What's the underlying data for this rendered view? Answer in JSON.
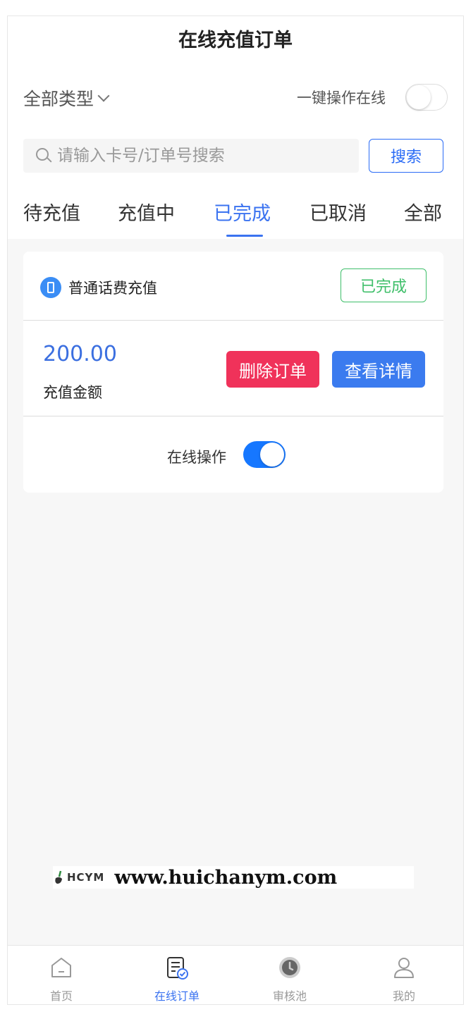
{
  "header": {
    "title": "在线充值订单"
  },
  "filter": {
    "type_label": "全部类型",
    "onekey_label": "一键操作在线",
    "onekey_on": false
  },
  "search": {
    "placeholder": "请输入卡号/订单号搜索",
    "button_label": "搜索"
  },
  "tabs": [
    {
      "label": "待充值",
      "active": false
    },
    {
      "label": "充值中",
      "active": false
    },
    {
      "label": "已完成",
      "active": true
    },
    {
      "label": "已取消",
      "active": false
    },
    {
      "label": "全部",
      "active": false
    }
  ],
  "order": {
    "type": "普通话费充值",
    "status": "已完成",
    "amount": "200.00",
    "amount_label": "充值金额",
    "delete_label": "删除订单",
    "detail_label": "查看详情",
    "online_label": "在线操作",
    "online_on": true
  },
  "watermark": {
    "logo": "HCYM",
    "url": "www.huichanym.com"
  },
  "bottom_nav": [
    {
      "label": "首页",
      "icon": "home-icon",
      "active": false
    },
    {
      "label": "在线订单",
      "icon": "order-icon",
      "active": true
    },
    {
      "label": "审核池",
      "icon": "clock-icon",
      "active": false
    },
    {
      "label": "我的",
      "icon": "user-icon",
      "active": false
    }
  ],
  "colors": {
    "accent": "#3b73f0",
    "success": "#3fbf6a",
    "danger": "#f0325a",
    "primary_button": "#3b7bef"
  }
}
